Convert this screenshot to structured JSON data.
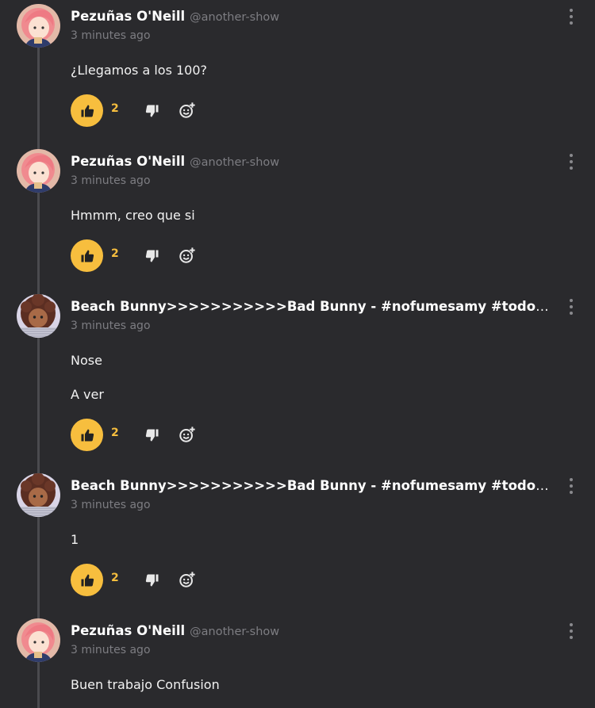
{
  "colors": {
    "background": "#2a2a2d",
    "accent": "#f7be3e",
    "muted": "#7d7d82"
  },
  "comments": [
    {
      "author": "Pezuñas O'Neill",
      "handle": "@another-show",
      "time": "3 minutes ago",
      "lines": [
        "¿Llegamos a los 100?"
      ],
      "likes": "2",
      "avatar": "pink-haired-girl-avatar"
    },
    {
      "author": "Pezuñas O'Neill",
      "handle": "@another-show",
      "time": "3 minutes ago",
      "lines": [
        "Hmmm, creo que si"
      ],
      "likes": "2",
      "avatar": "pink-haired-girl-avatar"
    },
    {
      "author": "Beach Bunny>>>>>>>>>>>Bad Bunny - #nofumesamy #todossomosann...",
      "handle": "",
      "time": "3 minutes ago",
      "lines": [
        "Nose",
        "A ver"
      ],
      "likes": "2",
      "avatar": "curly-haired-girl-avatar"
    },
    {
      "author": "Beach Bunny>>>>>>>>>>>Bad Bunny - #nofumesamy #todossomosann...",
      "handle": "",
      "time": "3 minutes ago",
      "lines": [
        "1"
      ],
      "likes": "2",
      "avatar": "curly-haired-girl-avatar"
    },
    {
      "author": "Pezuñas O'Neill",
      "handle": "@another-show",
      "time": "3 minutes ago",
      "lines": [
        "Buen trabajo Confusion"
      ],
      "likes": "",
      "avatar": "pink-haired-girl-avatar"
    }
  ]
}
